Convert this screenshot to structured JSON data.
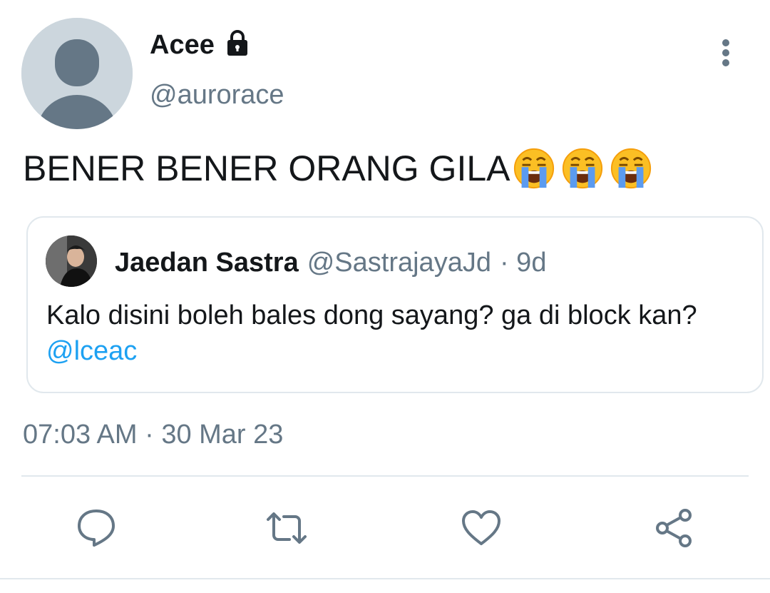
{
  "author": {
    "display_name": "Acee",
    "handle": "@aurorace",
    "protected_icon": "lock-icon"
  },
  "tweet": {
    "text": "BENER BENER ORANG GILA",
    "emojis": [
      "loudly-crying-face",
      "loudly-crying-face",
      "loudly-crying-face"
    ],
    "timestamp": "07:03 AM · 30 Mar 23"
  },
  "quoted_tweet": {
    "display_name": "Jaedan Sastra",
    "handle": "@SastrajayaJd",
    "age": "· 9d",
    "text": "Kalo disini boleh bales dong sayang? ga di block kan?",
    "mention": "@lceac"
  },
  "actions": [
    "reply-icon",
    "retweet-icon",
    "like-icon",
    "share-icon"
  ],
  "colors": {
    "text": "#14171a",
    "secondary": "#657786",
    "link": "#1da1f2",
    "border": "#e1e8ed",
    "avatar_bg": "#ccd6dd",
    "avatar_fg": "#657786"
  }
}
